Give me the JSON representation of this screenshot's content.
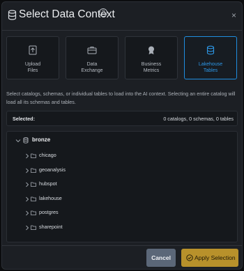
{
  "dialog": {
    "title": "Select Data Context",
    "help_glyph": "?",
    "close_glyph": "×"
  },
  "sources": [
    {
      "label": "Upload\nFiles",
      "icon": "upload-icon",
      "active": false
    },
    {
      "label": "Data\nExchange",
      "icon": "briefcase-icon",
      "active": false
    },
    {
      "label": "Business\nMetrics",
      "icon": "badge-icon",
      "active": false
    },
    {
      "label": "Lakehouse\nTables",
      "icon": "database-icon",
      "active": true
    }
  ],
  "description": "Select catalogs, schemas, or individual tables to load into the AI context. Selecting an entire catalog will load all its schemas and tables.",
  "selected": {
    "label": "Selected:",
    "summary": "0 catalogs, 0 schemas, 0 tables"
  },
  "tree": {
    "catalog": "bronze",
    "schemas": [
      "chicago",
      "geoanalysis",
      "hubspot",
      "lakehouse",
      "postgres",
      "sharepoint"
    ]
  },
  "footer": {
    "cancel_label": "Cancel",
    "apply_label": "Apply Selection"
  },
  "colors": {
    "accent_blue": "#1f8ee0",
    "apply_gold": "#b8912b",
    "cancel_slate": "#5b6778",
    "dialog_bg": "#1c1f24"
  }
}
